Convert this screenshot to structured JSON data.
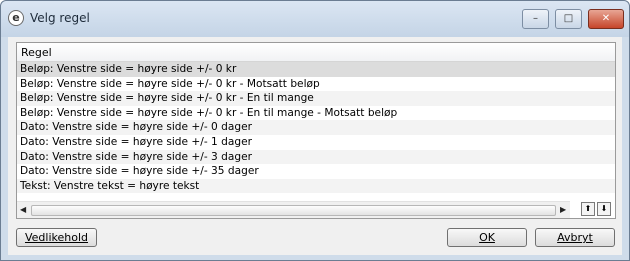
{
  "window": {
    "title": "Velg regel",
    "app_icon": "app-logo-icon",
    "minimize": "–",
    "maximize": "□",
    "close": "✕"
  },
  "list": {
    "column_header": "Regel",
    "selected_index": 0,
    "rows": [
      "Beløp: Venstre side = høyre side +/- 0 kr",
      "Beløp: Venstre side = høyre side +/- 0 kr - Motsatt beløp",
      "Beløp: Venstre side = høyre side +/- 0 kr - En til mange",
      "Beløp: Venstre side = høyre side +/- 0 kr - En til mange - Motsatt beløp",
      "Dato: Venstre side = høyre side +/- 0 dager",
      "Dato: Venstre side = høyre side +/- 1 dager",
      "Dato: Venstre side = høyre side +/- 3 dager",
      "Dato: Venstre side = høyre side +/- 35 dager",
      "Tekst:  Venstre tekst = høyre tekst"
    ]
  },
  "scrollbar": {
    "left_arrow": "◀",
    "right_arrow": "▶"
  },
  "nav": {
    "up_label": "⬆",
    "down_label": "⬇"
  },
  "buttons": {
    "maintenance": "Vedlikehold",
    "ok": "OK",
    "cancel": "Avbryt"
  }
}
